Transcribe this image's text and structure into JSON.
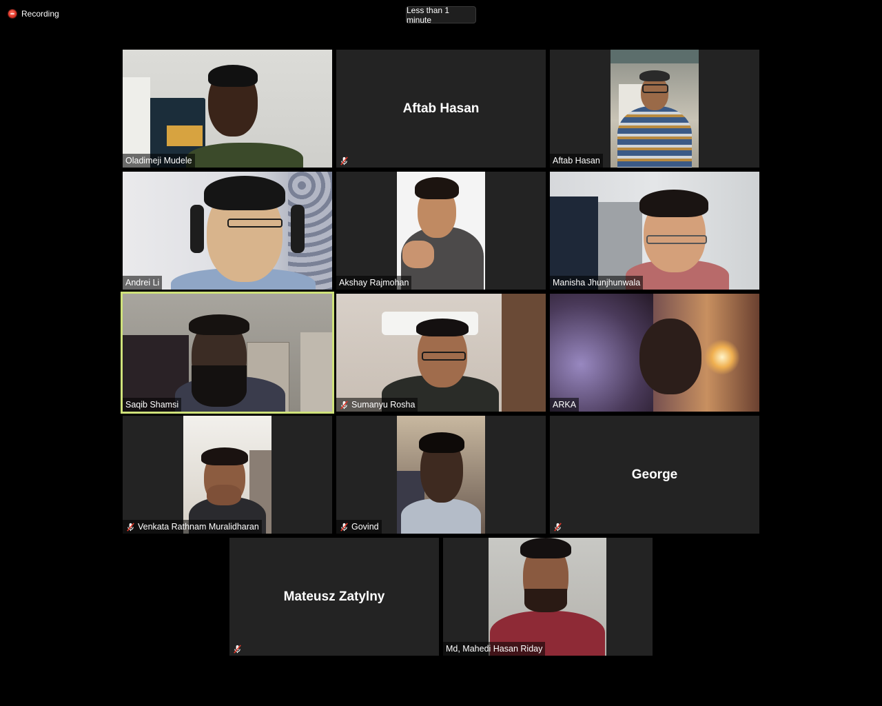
{
  "recording": {
    "label": "Recording",
    "icon": "record-dot-icon",
    "color": "#e0382a"
  },
  "timer": {
    "label": "Less than 1 minute"
  },
  "active_speaker_color": "#cfe27a",
  "participants": [
    {
      "name": "Oladimeji Mudele",
      "video": true,
      "muted": false
    },
    {
      "name": "Aftab Hasan",
      "video": false,
      "muted": true
    },
    {
      "name": "Aftab Hasan",
      "video": true,
      "muted": false
    },
    {
      "name": "Andrei Li",
      "video": true,
      "muted": false
    },
    {
      "name": "Akshay Rajmohan",
      "video": true,
      "muted": false
    },
    {
      "name": "Manisha Jhunjhunwala",
      "video": true,
      "muted": false
    },
    {
      "name": "Saqib Shamsi",
      "video": true,
      "muted": false,
      "active_speaker": true
    },
    {
      "name": "Sumanyu Rosha",
      "video": true,
      "muted": true
    },
    {
      "name": "ARKA",
      "video": true,
      "muted": false
    },
    {
      "name": "Venkata Rathnam Muralidharan",
      "video": true,
      "muted": true
    },
    {
      "name": "Govind",
      "video": true,
      "muted": true
    },
    {
      "name": "George",
      "video": false,
      "muted": true
    },
    {
      "name": "Mateusz Zatylny",
      "video": false,
      "muted": true
    },
    {
      "name": "Md, Mahedi Hasan Riday",
      "video": true,
      "muted": false
    }
  ]
}
